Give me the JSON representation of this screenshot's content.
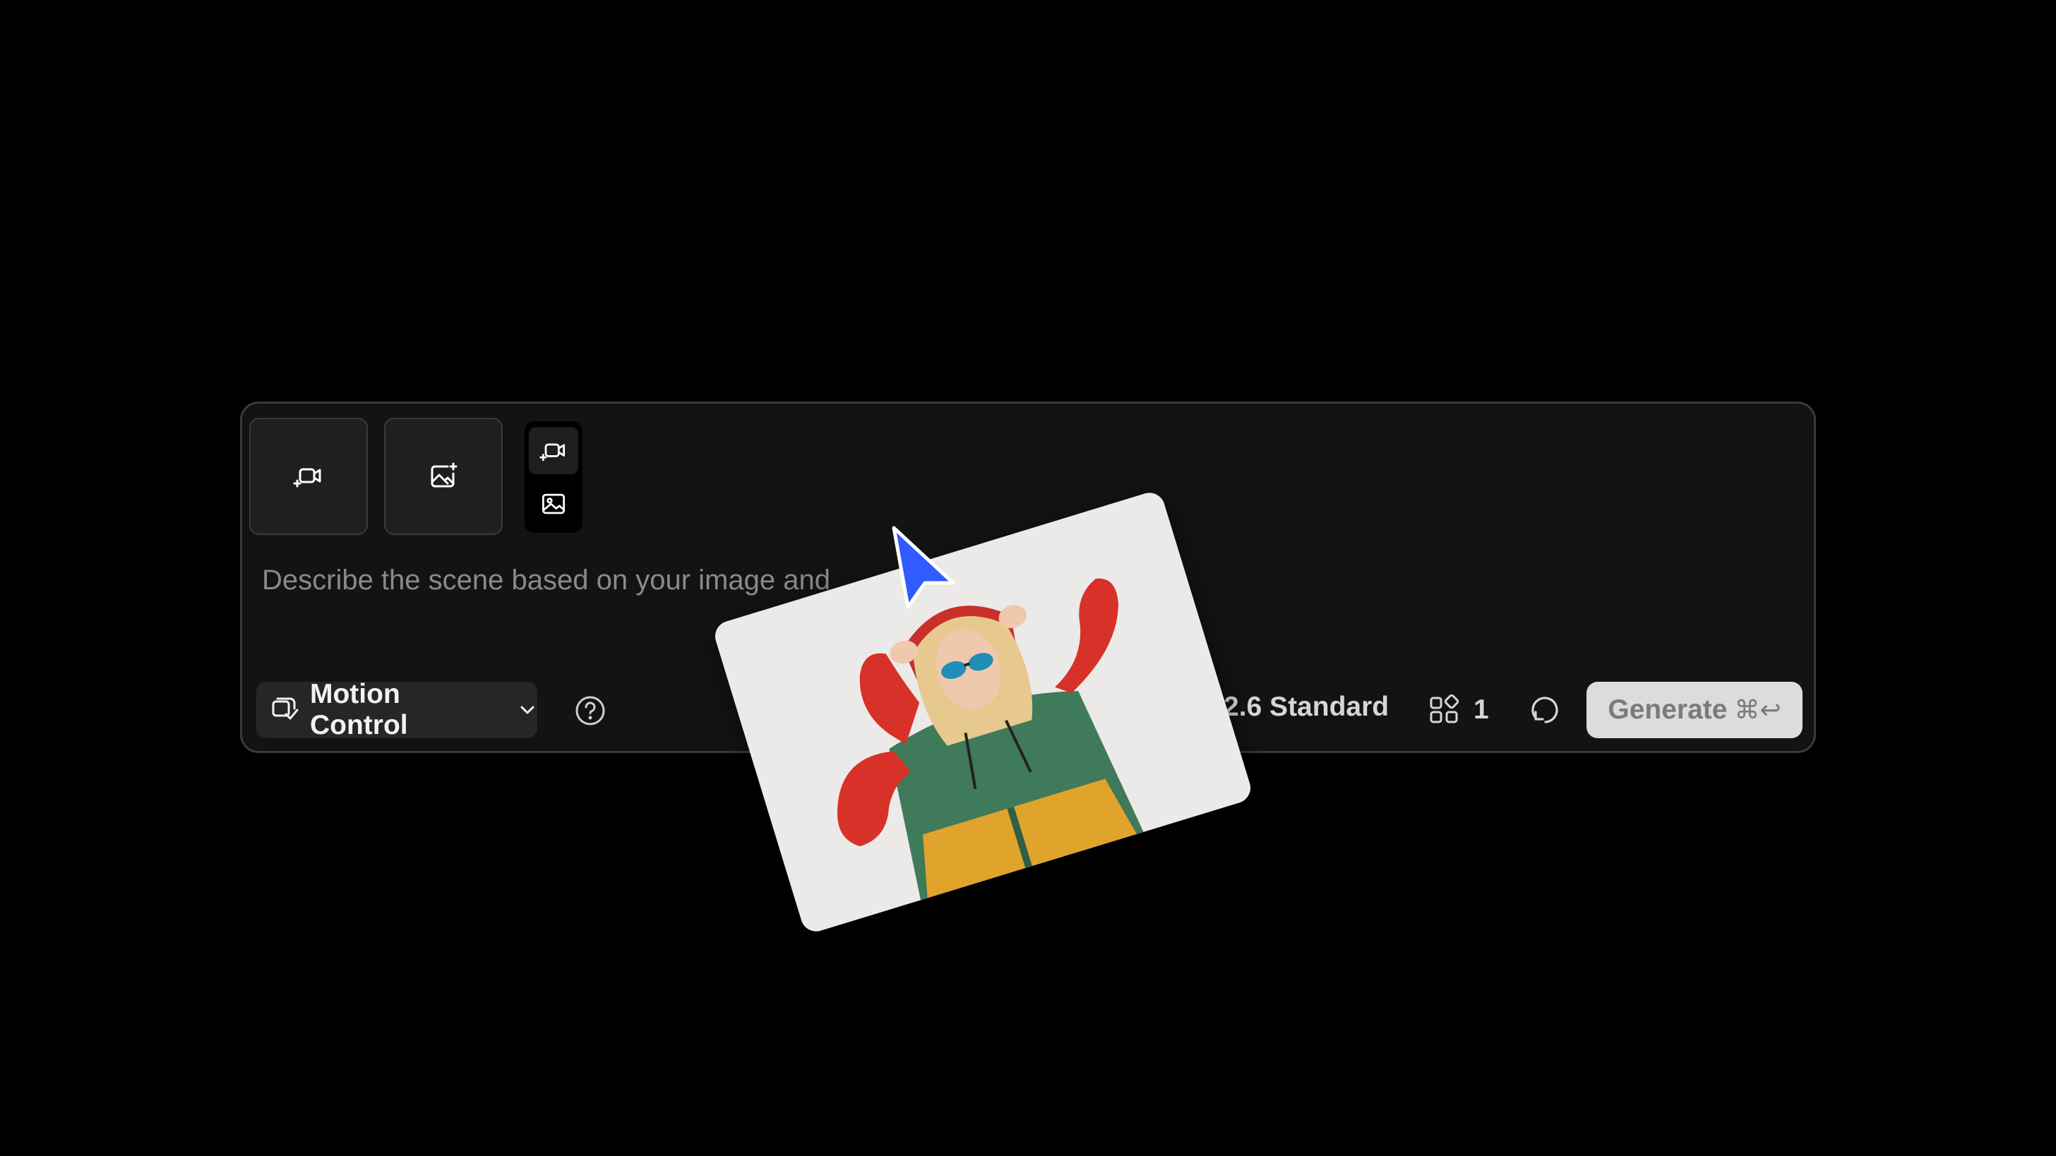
{
  "composer": {
    "tiles": [
      {
        "icon": "video-sparkle-icon"
      },
      {
        "icon": "image-sparkle-icon"
      }
    ],
    "mode_switch": [
      {
        "icon": "video-sparkle-icon",
        "active": true
      },
      {
        "icon": "image-icon",
        "active": false
      }
    ],
    "prompt_placeholder": "Describe the scene based on your image and",
    "mode": {
      "label": "Motion Control",
      "icon": "motion-control-icon"
    },
    "model_label": "2.6 Standard",
    "count": "1",
    "generate": {
      "label": "Generate",
      "shortcut": "⌘↩"
    }
  },
  "colors": {
    "panel": "#131313",
    "accent_cursor": "#2F5BFF",
    "generate_bg": "#DCDCDC"
  }
}
